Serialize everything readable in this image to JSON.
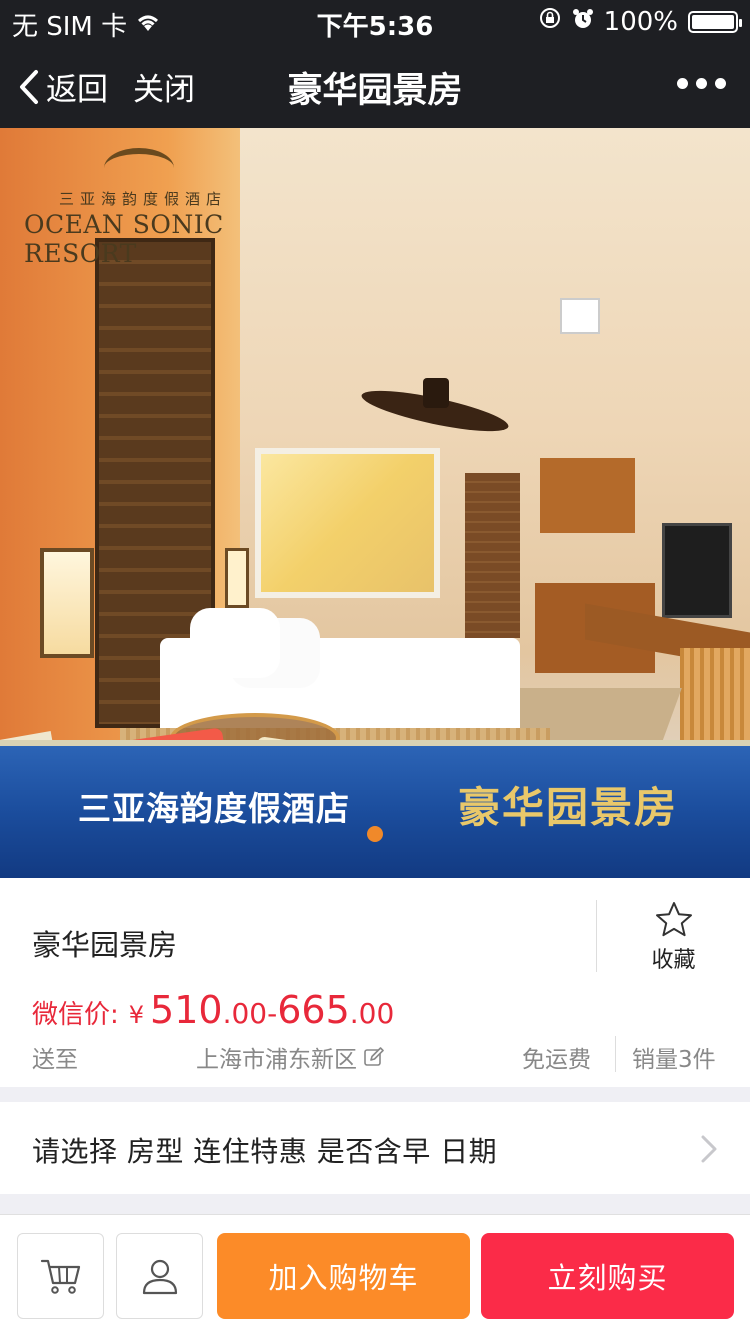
{
  "status_bar": {
    "carrier": "无 SIM 卡",
    "time": "下午5:36",
    "battery": "100%",
    "battery_level": 1.0
  },
  "nav": {
    "back_label": "返回",
    "close_label": "关闭",
    "title": "豪华园景房"
  },
  "banner": {
    "logo_cn": "三亚海韵度假酒店",
    "logo_en": "OCEAN SONIC RESORT",
    "hotel_name": "三亚海韵度假酒店",
    "room_name": "豪华园景房",
    "carousel_active_index": 0
  },
  "product": {
    "name": "豪华园景房",
    "favorite_label": "收藏",
    "price_label": "微信价:",
    "currency": "¥",
    "price_min_int": "510",
    "price_min_dec": ".00",
    "price_sep": "-",
    "price_max_int": "665",
    "price_max_dec": ".00",
    "ship_to_label": "送至",
    "location": "上海市浦东新区",
    "shipping": "免运费",
    "sales": "销量3件"
  },
  "select_row": {
    "text": "请选择 房型 连住特惠 是否含早 日期"
  },
  "bottom_bar": {
    "add_to_cart": "加入购物车",
    "buy_now": "立刻购买"
  },
  "colors": {
    "nav_bg": "#1e1f23",
    "price_red": "#e8283a",
    "add_orange": "#fc8b28",
    "buy_red": "#fb2b48"
  },
  "icons": {
    "wifi": "wifi-icon",
    "lock_rotation": "rotation-lock-icon",
    "alarm": "alarm-icon",
    "back": "chevron-left-icon",
    "more": "more-dots-icon",
    "star": "star-outline-icon",
    "edit": "edit-icon",
    "arrow": "chevron-right-icon",
    "cart": "cart-icon",
    "user": "user-icon"
  }
}
